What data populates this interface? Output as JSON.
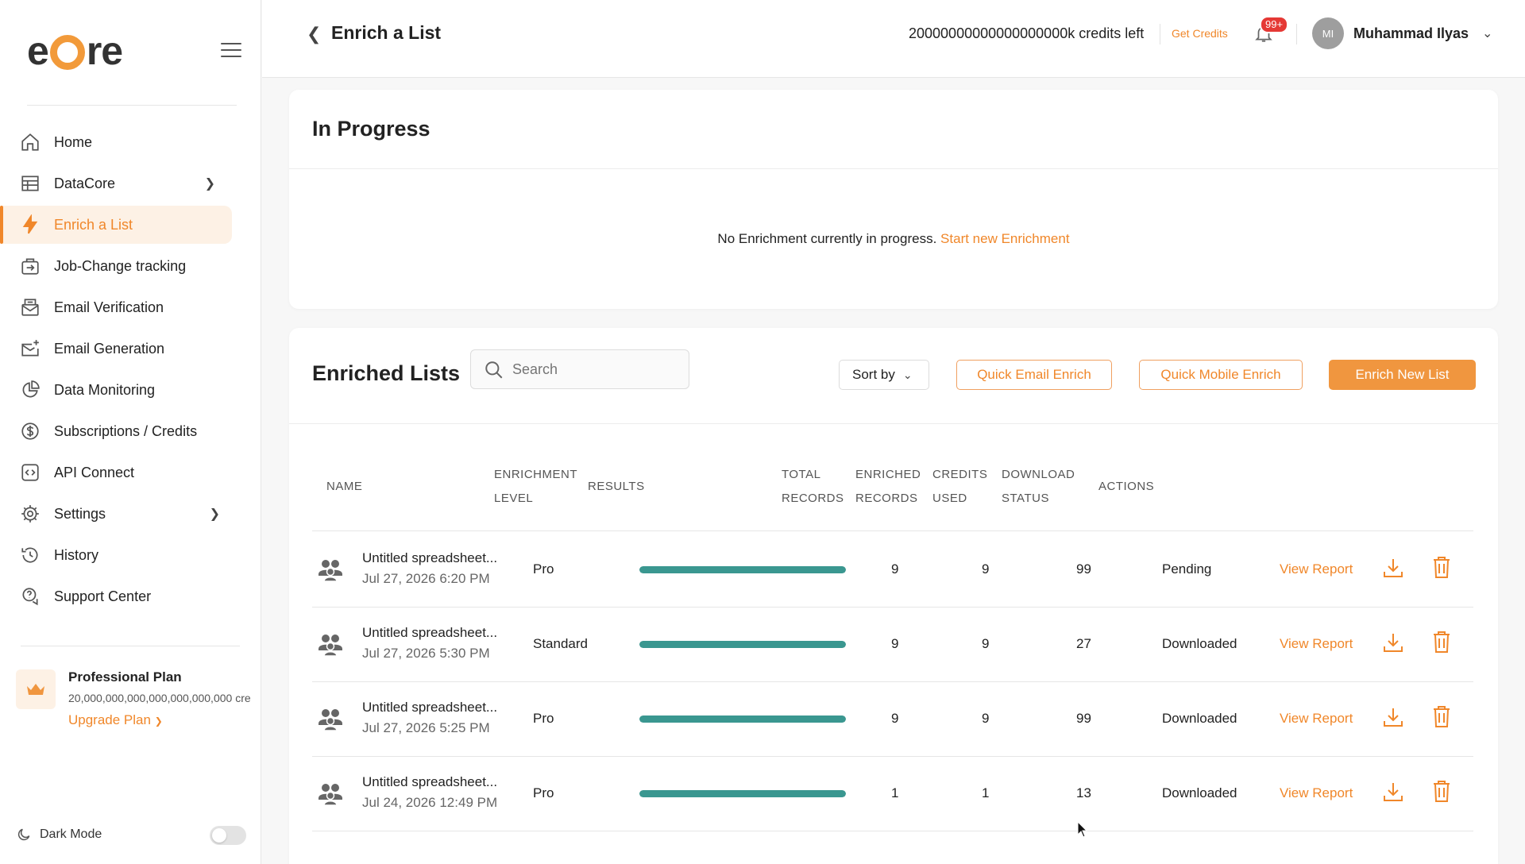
{
  "brand": {
    "logo_text_pre": "e",
    "logo_text_post": "re",
    "accent": "#f0872a"
  },
  "sidebar": {
    "items": [
      {
        "label": "Home",
        "icon": "home-icon",
        "active": false,
        "has_chevron": false
      },
      {
        "label": "DataCore",
        "icon": "table-icon",
        "active": false,
        "has_chevron": true
      },
      {
        "label": "Enrich a List",
        "icon": "lightning-icon",
        "active": true,
        "has_chevron": false
      },
      {
        "label": "Job-Change tracking",
        "icon": "briefcase-icon",
        "active": false,
        "has_chevron": false
      },
      {
        "label": "Email Verification",
        "icon": "email-check-icon",
        "active": false,
        "has_chevron": false
      },
      {
        "label": "Email Generation",
        "icon": "email-plus-icon",
        "active": false,
        "has_chevron": false
      },
      {
        "label": "Data Monitoring",
        "icon": "pie-chart-icon",
        "active": false,
        "has_chevron": false
      },
      {
        "label": "Subscriptions / Credits",
        "icon": "dollar-icon",
        "active": false,
        "has_chevron": false
      },
      {
        "label": "API Connect",
        "icon": "code-icon",
        "active": false,
        "has_chevron": false
      },
      {
        "label": "Settings",
        "icon": "gear-icon",
        "active": false,
        "has_chevron": true
      },
      {
        "label": "History",
        "icon": "history-icon",
        "active": false,
        "has_chevron": false
      },
      {
        "label": "Support Center",
        "icon": "support-icon",
        "active": false,
        "has_chevron": false
      }
    ],
    "plan": {
      "title": "Professional Plan",
      "credits": "20,000,000,000,000,000,000,000 cre",
      "upgrade": "Upgrade Plan"
    },
    "dark_mode": {
      "label": "Dark Mode",
      "enabled": false
    }
  },
  "header": {
    "back_icon": "chevron-left-icon",
    "title": "Enrich a List",
    "credits_left": "20000000000000000000k credits left",
    "get_credits": "Get Credits",
    "notification_badge": "99+",
    "avatar_initials": "MI",
    "user_name": "Muhammad Ilyas"
  },
  "in_progress": {
    "title": "In Progress",
    "empty_text": "No Enrichment currently in progress.",
    "empty_link": "Start new Enrichment"
  },
  "enriched": {
    "title": "Enriched Lists",
    "search_placeholder": "Search",
    "sort_label": "Sort by",
    "quick_email": "Quick Email Enrich",
    "quick_mobile": "Quick Mobile Enrich",
    "enrich_new": "Enrich New List",
    "columns": {
      "name": "NAME",
      "level_1": "ENRICHMENT",
      "level_2": "LEVEL",
      "results": "RESULTS",
      "total_1": "TOTAL",
      "total_2": "RECORDS",
      "enriched_1": "ENRICHED",
      "enriched_2": "RECORDS",
      "credits_1": "CREDITS",
      "credits_2": "USED",
      "download_1": "DOWNLOAD",
      "download_2": "STATUS",
      "actions": "ACTIONS"
    },
    "rows": [
      {
        "name": "Untitled spreadsheet...",
        "date": "Jul 27, 2026 6:20 PM",
        "level": "Pro",
        "progress": 1.0,
        "total": "9",
        "enriched": "9",
        "credits": "99",
        "status": "Pending",
        "view": "View Report"
      },
      {
        "name": "Untitled spreadsheet...",
        "date": "Jul 27, 2026 5:30 PM",
        "level": "Standard",
        "progress": 1.0,
        "total": "9",
        "enriched": "9",
        "credits": "27",
        "status": "Downloaded",
        "view": "View Report"
      },
      {
        "name": "Untitled spreadsheet...",
        "date": "Jul 27, 2026 5:25 PM",
        "level": "Pro",
        "progress": 1.0,
        "total": "9",
        "enriched": "9",
        "credits": "99",
        "status": "Downloaded",
        "view": "View Report"
      },
      {
        "name": "Untitled spreadsheet...",
        "date": "Jul 24, 2026 12:49 PM",
        "level": "Pro",
        "progress": 1.0,
        "total": "1",
        "enriched": "1",
        "credits": "13",
        "status": "Downloaded",
        "view": "View Report"
      }
    ]
  }
}
